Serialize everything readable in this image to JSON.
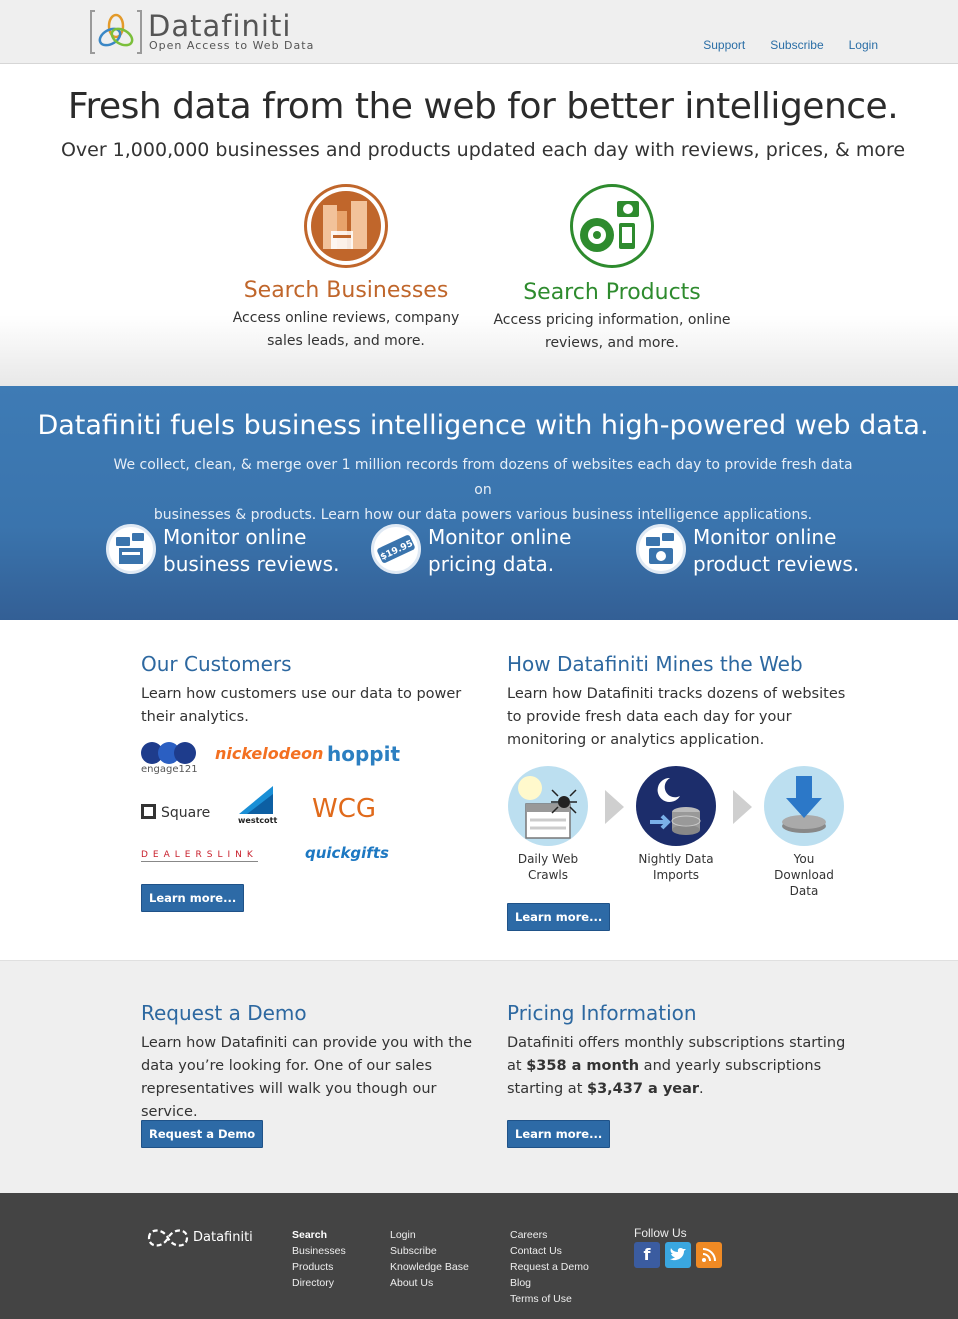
{
  "header": {
    "logo_name": "Datafiniti",
    "logo_tagline": "Open Access to Web Data",
    "nav": [
      "Support",
      "Subscribe",
      "Login"
    ]
  },
  "hero": {
    "title": "Fresh data from the web for better intelligence.",
    "subtitle": "Over 1,000,000 businesses and products updated each day with reviews, prices, & more",
    "businesses": {
      "title": "Search Businesses",
      "desc_line1": "Access online reviews, company",
      "desc_line2": "sales leads, and more."
    },
    "products": {
      "title": "Search Products",
      "desc_line1": "Access pricing information, online",
      "desc_line2": "reviews, and more."
    }
  },
  "band": {
    "title": "Datafiniti fuels business intelligence with high-powered web data.",
    "desc_line1": "We collect, clean, & merge over 1 million records from dozens of websites each day to provide fresh data on",
    "desc_line2": "businesses & products. Learn how our data powers various business intelligence applications.",
    "features": [
      {
        "line1": "Monitor online",
        "line2": "business reviews."
      },
      {
        "line1": "Monitor online",
        "line2": "pricing data.",
        "price_tag": "$19.95"
      },
      {
        "line1": "Monitor online",
        "line2": "product reviews."
      }
    ]
  },
  "customers": {
    "title": "Our Customers",
    "desc": "Learn how customers use our data to power their analytics.",
    "logos": [
      "engage121",
      "nickelodeon",
      "hoppit",
      "Square",
      "westcott",
      "WCG",
      "DEALERSLINK",
      "quickgifts"
    ],
    "button": "Learn more..."
  },
  "mines": {
    "title": "How Datafiniti Mines the Web",
    "desc": "Learn how Datafiniti tracks dozens of websites to provide fresh data each day for your monitoring or analytics application.",
    "steps": [
      {
        "line1": "Daily Web",
        "line2": "Crawls"
      },
      {
        "line1": "Nightly Data",
        "line2": "Imports"
      },
      {
        "line1": "You Download",
        "line2": "Data"
      }
    ],
    "button": "Learn more..."
  },
  "demo": {
    "title": "Request a Demo",
    "desc": "Learn how Datafiniti can provide you with the data you’re looking for. One of our sales representatives will walk you though our service.",
    "button": "Request a Demo"
  },
  "pricing": {
    "title": "Pricing Information",
    "desc_pre": "Datafiniti offers monthly subscriptions starting at ",
    "monthly": "$358 a month",
    "desc_mid": " and yearly subscriptions starting at ",
    "yearly": "$3,437 a year",
    "desc_post": ".",
    "button": "Learn more..."
  },
  "footer": {
    "logo_name": "Datafiniti",
    "col1": [
      "Search",
      "Businesses",
      "Products",
      "Directory"
    ],
    "col2": [
      "Login",
      "Subscribe",
      "Knowledge Base",
      "About Us"
    ],
    "col3": [
      "Careers",
      "Contact Us",
      "Request a Demo",
      "Blog",
      "Terms of Use"
    ],
    "follow": "Follow Us",
    "social": [
      "facebook",
      "twitter",
      "rss"
    ]
  },
  "colors": {
    "brand_blue": "#2d68a0",
    "band_blue": "#3a74ad",
    "business_orange": "#c0662b",
    "product_green": "#2e8b2e",
    "footer_bg": "#444444"
  }
}
